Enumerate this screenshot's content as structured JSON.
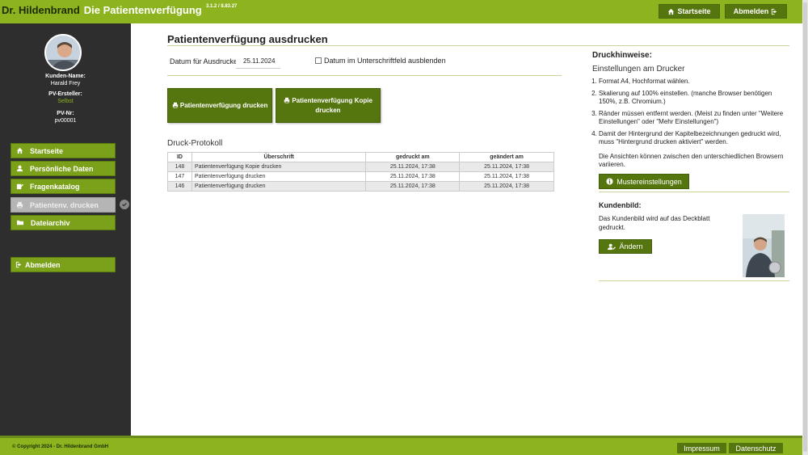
{
  "header": {
    "brand_name": "Dr. Hildenbrand",
    "app_title": "Die Patientenverfügung",
    "version": "3.1.2 / 8.83.27",
    "home_label": "Startseite",
    "logout_label": "Abmelden"
  },
  "sidebar": {
    "customer_name_label": "Kunden-Name:",
    "customer_name": "Harald Frey",
    "creator_label": "PV-Ersteller:",
    "creator": "Selbst",
    "pv_no_label": "PV-Nr:",
    "pv_no": "pv00001",
    "nav": [
      {
        "label": "Startseite",
        "icon": "home-icon"
      },
      {
        "label": "Persönliche Daten",
        "icon": "user-icon"
      },
      {
        "label": "Fragenkatalog",
        "icon": "edit-icon"
      },
      {
        "label": "Patientenv. drucken",
        "icon": "print-icon",
        "disabled": true
      },
      {
        "label": "Dateiarchiv",
        "icon": "folder-icon"
      }
    ],
    "logout_label": "Abmelden"
  },
  "main": {
    "title": "Patientenverfügung ausdrucken",
    "date_label": "Datum für Ausdrucke:",
    "date_value": "25.11.2024",
    "hide_date_label": "Datum im Unterschriftfeld ausblenden",
    "print_button": "Patientenverfügung drucken",
    "print_copy_button_line1": "Patientenverfügung Kopie",
    "print_copy_button_line2": "drucken",
    "protocol_title": "Druck-Protokoll",
    "protocol_headers": [
      "ID",
      "Überschrift",
      "gedruckt am",
      "geändert am"
    ],
    "protocol_rows": [
      {
        "id": "148",
        "title": "Patientenverfügung Kopie drucken",
        "printed": "25.11.2024, 17:38",
        "changed": "25.11.2024, 17:38"
      },
      {
        "id": "147",
        "title": "Patientenverfügung drucken",
        "printed": "25.11.2024, 17:38",
        "changed": "25.11.2024, 17:38"
      },
      {
        "id": "146",
        "title": "Patientenverfügung drucken",
        "printed": "25.11.2024, 17:38",
        "changed": "25.11.2024, 17:38"
      }
    ]
  },
  "right_panel": {
    "title": "Druckhinweise:",
    "subtitle": "Einstellungen am Drucker",
    "steps": [
      "Format A4, Hochformat wählen.",
      "Skalierung auf 100% einstellen. (manche Browser benötigen 150%, z.B. Chromium.)",
      "Ränder müssen entfernt werden. (Meist zu finden unter \"Weitere Einstellungen\" oder \"Mehr Einstellungen\")",
      "Damit der Hintergrund der Kapitelbezeichnungen gedruckt wird, muss \"Hintergrund drucken aktiviert\" werden."
    ],
    "note": "Die Ansichten können zwischen den unterschiedlichen Browsern variieren.",
    "sample_settings_button": "Mustereinstellungen",
    "customer_image_title": "Kundenbild:",
    "customer_image_text": "Das Kundenbild wird auf das Deckblatt gedruckt.",
    "change_button": "Ändern"
  },
  "footer": {
    "copyright": "© Copyright 2024 - Dr. Hildenbrand GmbH",
    "imprint": "Impressum",
    "privacy": "Datenschutz"
  }
}
